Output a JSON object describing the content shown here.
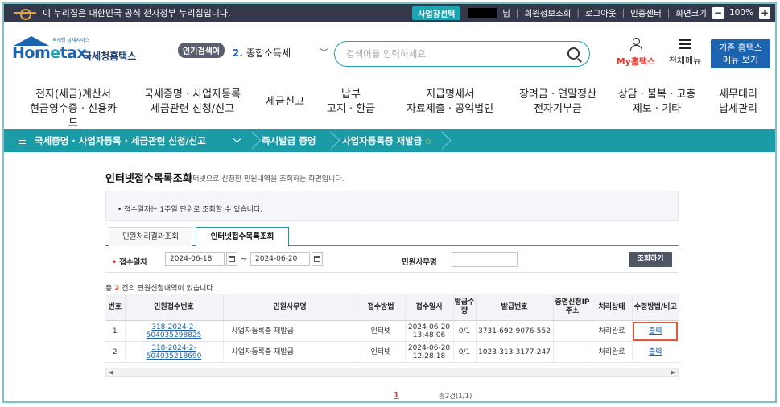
{
  "govbar": {
    "text": "이 누리집은 대한민국 공식 전자정부 누리집입니다.",
    "biz_select": "사업장선택",
    "user_suffix": "님",
    "links": [
      "회원정보조회",
      "로그아웃",
      "인증센터",
      "화면크기"
    ],
    "zoom_minus": "−",
    "zoom_value": "100%",
    "zoom_plus": "+"
  },
  "header": {
    "logo_small": "국세청 납세서비스",
    "logo_main_pre": "Hom",
    "logo_main_e": "e",
    "logo_main_post": "tax.",
    "logo_kor": "국세청홈택스",
    "popular_label": "인기검색어",
    "popular_rank": "2.",
    "popular_keyword": "종합소득세",
    "search_placeholder": "검색어를 입력하세요.",
    "myhome": "My홈택스",
    "allmenu": "전체메뉴",
    "oldhome_line1": "기존 홈택스",
    "oldhome_line2": "메뉴 보기"
  },
  "mainnav": [
    {
      "l1": "전자(세금)계산서",
      "l2": "현금영수증 · 신용카드"
    },
    {
      "l1": "국세증명 · 사업자등록",
      "l2": "세금관련 신청/신고"
    },
    {
      "l1": "세금신고",
      "l2": ""
    },
    {
      "l1": "납부",
      "l2": "고지 · 환급"
    },
    {
      "l1": "지급명세서",
      "l2": "자료제출 · 공익법인"
    },
    {
      "l1": "장려금 · 연말정산",
      "l2": "전자기부금"
    },
    {
      "l1": "상담 · 불복 · 고충",
      "l2": "제보 · 기타"
    },
    {
      "l1": "세무대리",
      "l2": "납세관리"
    }
  ],
  "breadcrumb": {
    "item1": "국세증명 · 사업자등록 · 세금관련 신청/신고",
    "item2": "즉시발급 증명",
    "item3": "사업자등록증 재발급",
    "star": "☆"
  },
  "page": {
    "title": "인터넷접수목록조회",
    "desc": "인터넷으로 신청한 민원내역을 조회하는 화면입니다.",
    "notice": "• 접수일자는 1주일 단위로 조회할 수 있습니다.",
    "tabs": [
      "민원처리결과조회",
      "인터넷접수목록조회"
    ],
    "filter_label_date": "접수일자",
    "date_from": "2024-06-18",
    "tilde": "~",
    "date_to": "2024-06-20",
    "filter_label_office": "민원사무명",
    "query_button": "조회하기",
    "count_prefix": "총",
    "count_num": "2",
    "count_suffix": "건의 민원신청내역이 있습니다."
  },
  "table": {
    "headers": [
      "번호",
      "민원접수번호",
      "민원사무명",
      "접수방법",
      "접수일시",
      "발급수량",
      "발급번호",
      "증명신청IP주소",
      "처리상태",
      "수령방법/비고"
    ],
    "rows": [
      {
        "no": "1",
        "receipt": "318-2024-2-504035298825",
        "office": "사업자등록증 재발급",
        "method": "인터넷",
        "date": "2024-06-20",
        "time": "13:48:06",
        "qty": "0/1",
        "issue": "3731-692-9076-552",
        "ip": "",
        "status": "처리완료",
        "receive": "출력"
      },
      {
        "no": "2",
        "receipt": "318-2024-2-504035218690",
        "office": "사업자등록증 재발급",
        "method": "인터넷",
        "date": "2024-06-20",
        "time": "12:28:18",
        "qty": "0/1",
        "issue": "1023-313-3177-247",
        "ip": "",
        "status": "처리완료",
        "receive": "출력"
      }
    ]
  },
  "pager": {
    "current": "1",
    "total": "총2건(1/1)"
  }
}
